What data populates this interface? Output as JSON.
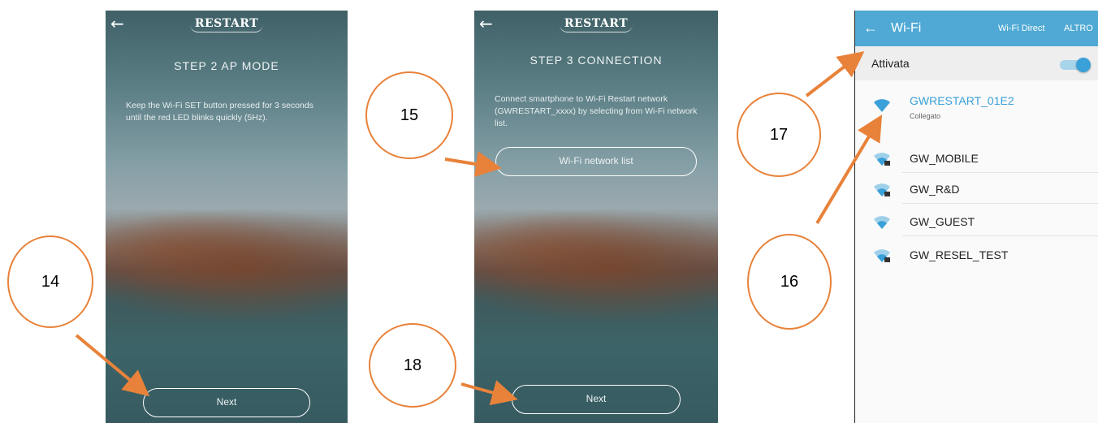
{
  "screen1": {
    "back_icon": "arrow-left-icon",
    "logo": "RESTART",
    "title": "STEP 2 AP MODE",
    "instructions": "Keep the Wi-Fi SET button pressed for 3 seconds until the red LED blinks quickly (5Hz).",
    "next_label": "Next"
  },
  "screen2": {
    "back_icon": "arrow-left-icon",
    "logo": "RESTART",
    "title": "STEP 3 CONNECTION",
    "instructions": "Connect smartphone to Wi-Fi Restart network (GWRESTART_xxxx) by selecting from Wi-Fi network list.",
    "wifi_list_label": "Wi-Fi network list",
    "next_label": "Next"
  },
  "android_wifi": {
    "title": "Wi-Fi",
    "wifi_direct_label": "Wi-Fi Direct",
    "more_label": "ALTRO",
    "toggle_label": "Attivata",
    "toggle_on": true,
    "networks": [
      {
        "name": "GWRESTART_01E2",
        "status": "Collegato",
        "secured": false
      },
      {
        "name": "GW_MOBILE",
        "status": "",
        "secured": true
      },
      {
        "name": "GW_R&D",
        "status": "",
        "secured": true
      },
      {
        "name": "GW_GUEST",
        "status": "",
        "secured": false
      },
      {
        "name": "GW_RESEL_TEST",
        "status": "",
        "secured": true
      }
    ]
  },
  "callouts": {
    "c14": "14",
    "c15": "15",
    "c16": "16",
    "c17": "17",
    "c18": "18"
  },
  "colors": {
    "accent": "#e8823a",
    "android_bar": "#4fa9d4",
    "connected_text": "#3aa0d8"
  }
}
